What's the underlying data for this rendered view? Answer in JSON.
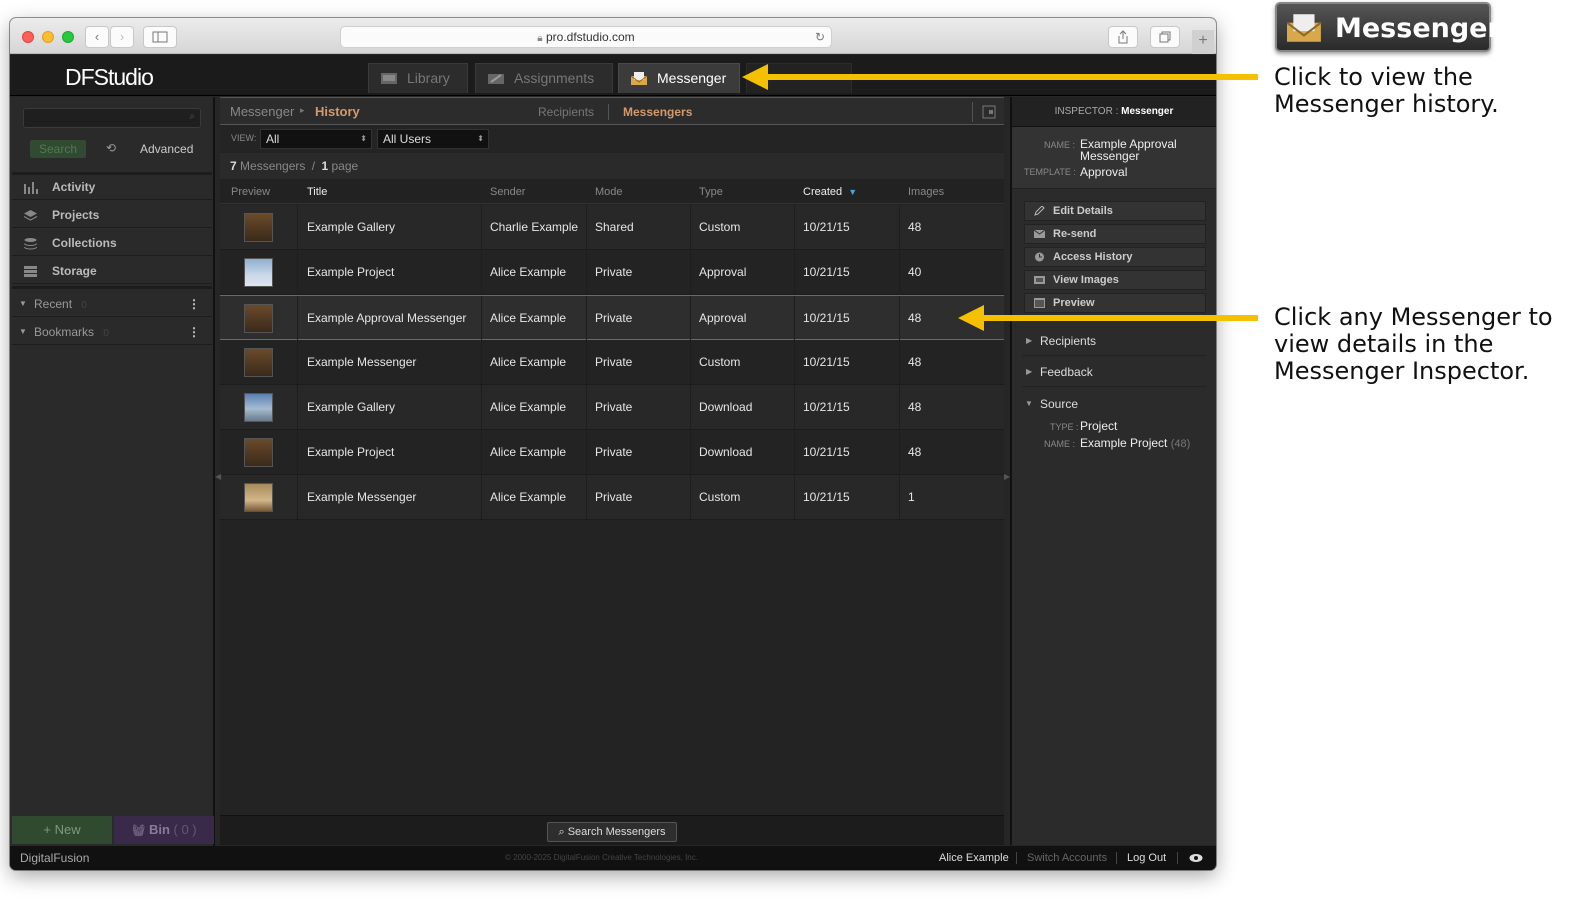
{
  "browser": {
    "url": "pro.dfstudio.com"
  },
  "app": {
    "logo": "DFStudio"
  },
  "nav_tabs": [
    {
      "label": "Library"
    },
    {
      "label": "Assignments"
    },
    {
      "label": "Messenger"
    }
  ],
  "left": {
    "search_label": "Search",
    "advanced_label": "Advanced",
    "items": [
      {
        "label": "Activity"
      },
      {
        "label": "Projects"
      },
      {
        "label": "Collections"
      },
      {
        "label": "Storage"
      }
    ],
    "recent": {
      "label": "Recent",
      "count": "0"
    },
    "bookmarks": {
      "label": "Bookmarks",
      "count": "0"
    },
    "new_label": "+ New",
    "bin_label": "Bin",
    "bin_count": "( 0 )"
  },
  "center": {
    "breadcrumb_root": "Messenger",
    "breadcrumb_current": "History",
    "tab_recipients": "Recipients",
    "tab_messengers": "Messengers",
    "view_label": "VIEW:",
    "view_value": "All",
    "users_value": "All Users",
    "count_num": "7",
    "count_label": "Messengers",
    "page_sep": "/",
    "page_num": "1",
    "page_label": "page",
    "columns": [
      "Preview",
      "Title",
      "Sender",
      "Mode",
      "Type",
      "Created",
      "Images"
    ],
    "rows": [
      {
        "title": "Example Gallery",
        "sender": "Charlie Example",
        "mode": "Shared",
        "type": "Custom",
        "created": "10/21/15",
        "images": "48"
      },
      {
        "title": "Example Project",
        "sender": "Alice Example",
        "mode": "Private",
        "type": "Approval",
        "created": "10/21/15",
        "images": "40"
      },
      {
        "title": "Example Approval Messenger",
        "sender": "Alice Example",
        "mode": "Private",
        "type": "Approval",
        "created": "10/21/15",
        "images": "48"
      },
      {
        "title": "Example Messenger",
        "sender": "Alice Example",
        "mode": "Private",
        "type": "Custom",
        "created": "10/21/15",
        "images": "48"
      },
      {
        "title": "Example Gallery",
        "sender": "Alice Example",
        "mode": "Private",
        "type": "Download",
        "created": "10/21/15",
        "images": "48"
      },
      {
        "title": "Example Project",
        "sender": "Alice Example",
        "mode": "Private",
        "type": "Download",
        "created": "10/21/15",
        "images": "48"
      },
      {
        "title": "Example Messenger",
        "sender": "Alice Example",
        "mode": "Private",
        "type": "Custom",
        "created": "10/21/15",
        "images": "1"
      }
    ],
    "search_button": "Search Messengers"
  },
  "inspector": {
    "header_label": "INSPECTOR :",
    "header_value": "Messenger",
    "name_label": "NAME :",
    "name_value": "Example Approval Messenger",
    "template_label": "TEMPLATE :",
    "template_value": "Approval",
    "buttons": [
      {
        "label": "Edit Details"
      },
      {
        "label": "Re-send"
      },
      {
        "label": "Access History"
      },
      {
        "label": "View Images"
      },
      {
        "label": "Preview"
      }
    ],
    "sections": [
      {
        "label": "Recipients"
      },
      {
        "label": "Feedback"
      },
      {
        "label": "Source"
      }
    ],
    "source_type_label": "TYPE :",
    "source_type_value": "Project",
    "source_name_label": "NAME :",
    "source_name_value": "Example Project",
    "source_name_count": "(48)"
  },
  "status": {
    "brand": "DigitalFusion",
    "copyright": "© 2000-2025 DigitalFusion Creative Technologies, Inc.",
    "user": "Alice Example",
    "switch": "Switch Accounts",
    "logout": "Log Out"
  },
  "annotations": {
    "badge": "Messenger",
    "note1": "Click to view the Messenger history.",
    "note2": "Click any Messenger to view details in the Messenger Inspector."
  },
  "colors": {
    "accent": "#f5c000",
    "selection": "#3d7a8a",
    "breadcrumb": "#d49a6a"
  }
}
